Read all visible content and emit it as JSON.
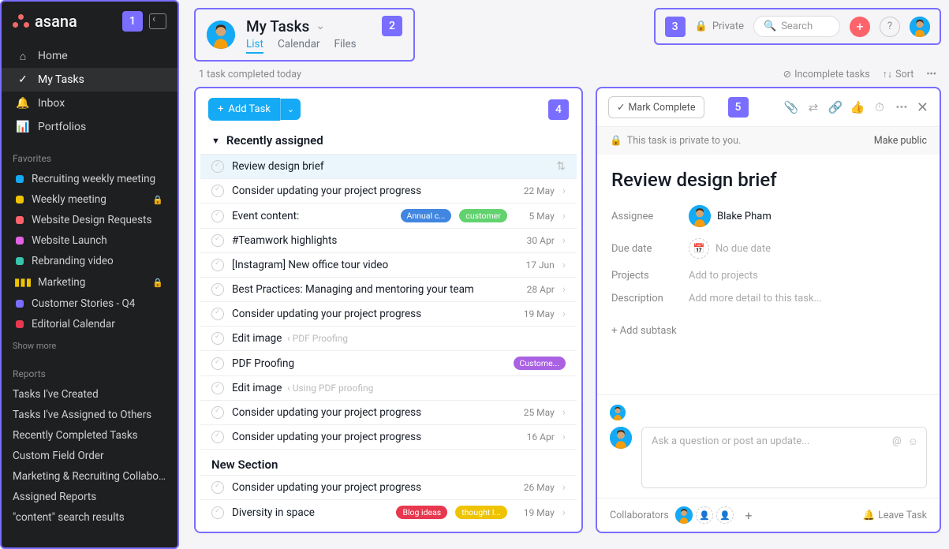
{
  "logo_text": "asana",
  "annotation_badges": {
    "sidebar": "1",
    "header_left": "2",
    "header_right": "3",
    "task_list": "4",
    "detail": "5"
  },
  "sidebar": {
    "nav": [
      {
        "label": "Home",
        "icon": "home"
      },
      {
        "label": "My Tasks",
        "icon": "check-circle",
        "active": true
      },
      {
        "label": "Inbox",
        "icon": "bell"
      },
      {
        "label": "Portfolios",
        "icon": "bars"
      }
    ],
    "favorites_title": "Favorites",
    "favorites": [
      {
        "label": "Recruiting weekly meeting",
        "color": "#14aaf5"
      },
      {
        "label": "Weekly meeting",
        "color": "#eec300",
        "locked": true
      },
      {
        "label": "Website Design Requests",
        "color": "#fc636b"
      },
      {
        "label": "Website Launch",
        "color": "#e362e3"
      },
      {
        "label": "Rebranding video",
        "color": "#37c5ab"
      },
      {
        "label": "Marketing",
        "color": "#eec300",
        "bars": true,
        "locked": true
      },
      {
        "label": "Customer Stories - Q4",
        "color": "#796eff"
      },
      {
        "label": "Editorial Calendar",
        "color": "#e8384f"
      }
    ],
    "show_more": "Show more",
    "reports_title": "Reports",
    "reports": [
      "Tasks I've Created",
      "Tasks I've Assigned to Others",
      "Recently Completed Tasks",
      "Custom Field Order",
      "Marketing & Recruiting Collabo...",
      "Assigned Reports",
      "\"content\" search results"
    ]
  },
  "header": {
    "title": "My Tasks",
    "tabs": [
      {
        "label": "List",
        "active": true
      },
      {
        "label": "Calendar"
      },
      {
        "label": "Files"
      }
    ],
    "private_label": "Private",
    "search_placeholder": "Search"
  },
  "subheader": {
    "completed_text": "1 task completed today",
    "incomplete_label": "Incomplete tasks",
    "sort_label": "Sort"
  },
  "task_panel": {
    "add_task": "Add Task",
    "section_title": "Recently assigned",
    "new_section": "New Section",
    "tasks": [
      {
        "title": "Review design brief",
        "selected": true,
        "move_icon": true
      },
      {
        "title": "Consider updating your project progress",
        "date": "22 May"
      },
      {
        "title": "Event content:",
        "tags": [
          {
            "text": "Annual c...",
            "cls": "tag-blue"
          },
          {
            "text": "customer",
            "cls": "tag-green"
          }
        ],
        "date": "5 May"
      },
      {
        "title": "#Teamwork highlights",
        "date": "30 Apr"
      },
      {
        "title": "[Instagram] New office tour video",
        "date": "17 Jun"
      },
      {
        "title": "Best Practices: Managing and mentoring your team",
        "date": "28 Apr"
      },
      {
        "title": "Consider updating your project progress",
        "date": "19 May"
      },
      {
        "title": "Edit image",
        "meta": "‹ PDF Proofing"
      },
      {
        "title": "PDF Proofing",
        "tags": [
          {
            "text": "Custome...",
            "cls": "tag-purple"
          }
        ]
      },
      {
        "title": "Edit image",
        "meta": "‹ Using PDF proofing"
      },
      {
        "title": "Consider updating your project progress",
        "date": "25 May"
      },
      {
        "title": "Consider updating your project progress",
        "date": "16 Apr"
      }
    ],
    "new_section_tasks": [
      {
        "title": "Consider updating your project progress",
        "date": "26 May"
      },
      {
        "title": "Diversity in space",
        "tags": [
          {
            "text": "Blog ideas",
            "cls": "tag-red"
          },
          {
            "text": "thought l...",
            "cls": "tag-yellow"
          }
        ],
        "date": "19 May"
      }
    ]
  },
  "detail": {
    "mark_complete": "Mark Complete",
    "private_notice": "This task is private to you.",
    "make_public": "Make public",
    "title": "Review design brief",
    "fields": {
      "assignee_label": "Assignee",
      "assignee_value": "Blake Pham",
      "due_label": "Due date",
      "due_value": "No due date",
      "projects_label": "Projects",
      "projects_value": "Add to projects",
      "desc_label": "Description",
      "desc_value": "Add more detail to this task..."
    },
    "add_subtask": "+  Add subtask",
    "comment_placeholder": "Ask a question or post an update...",
    "collaborators_label": "Collaborators",
    "leave_task": "Leave Task"
  }
}
